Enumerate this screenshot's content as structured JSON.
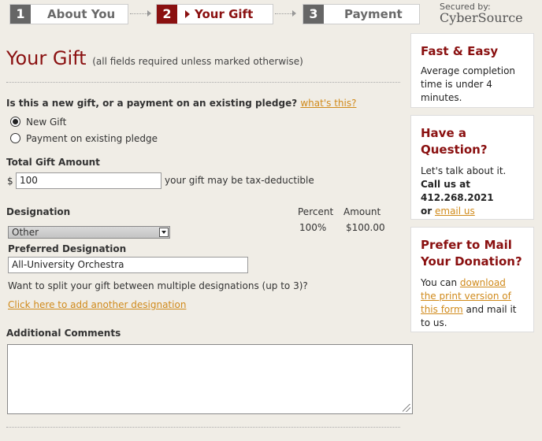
{
  "steps": [
    {
      "num": "1",
      "label": "About You"
    },
    {
      "num": "2",
      "label": "Your Gift"
    },
    {
      "num": "3",
      "label": "Payment"
    }
  ],
  "security": {
    "secured_by": "Secured by:",
    "provider": "CyberSource"
  },
  "page": {
    "title": "Your Gift",
    "title_note": "(all fields required unless marked otherwise)"
  },
  "gift_type": {
    "question": "Is this a new gift, or a payment on an existing pledge?",
    "help_link": "what's this?",
    "options": [
      "New Gift",
      "Payment on existing pledge"
    ],
    "selected": "New Gift"
  },
  "amount": {
    "label": "Total Gift Amount",
    "currency": "$",
    "value": "100",
    "note": "your gift may be tax-deductible"
  },
  "designation": {
    "label": "Designation",
    "selected": "Other",
    "percent_header": "Percent",
    "amount_header": "Amount",
    "percent": "100%",
    "amount": "$100.00",
    "preferred_label": "Preferred Designation",
    "preferred_value": "All-University Orchestra",
    "split_question": "Want to split your gift between multiple designations (up to 3)?",
    "add_link": "Click here to add another designation"
  },
  "comments": {
    "label": "Additional Comments",
    "value": ""
  },
  "sidebar": {
    "fast": {
      "title": "Fast & Easy",
      "text": "Average completion time is under 4 minutes."
    },
    "question": {
      "title": "Have a Question?",
      "line1": "Let's talk about it.",
      "call": "Call us at 412.268.2021",
      "or": "or",
      "email_link": "email us"
    },
    "mail": {
      "title": "Prefer to Mail Your Donation?",
      "text_pre": "You can",
      "link": "download the print version of this form",
      "text_post": "and mail it to us."
    }
  },
  "colors": {
    "accent": "#8a1010",
    "link": "#d08a1b",
    "background": "#f0ede6"
  }
}
